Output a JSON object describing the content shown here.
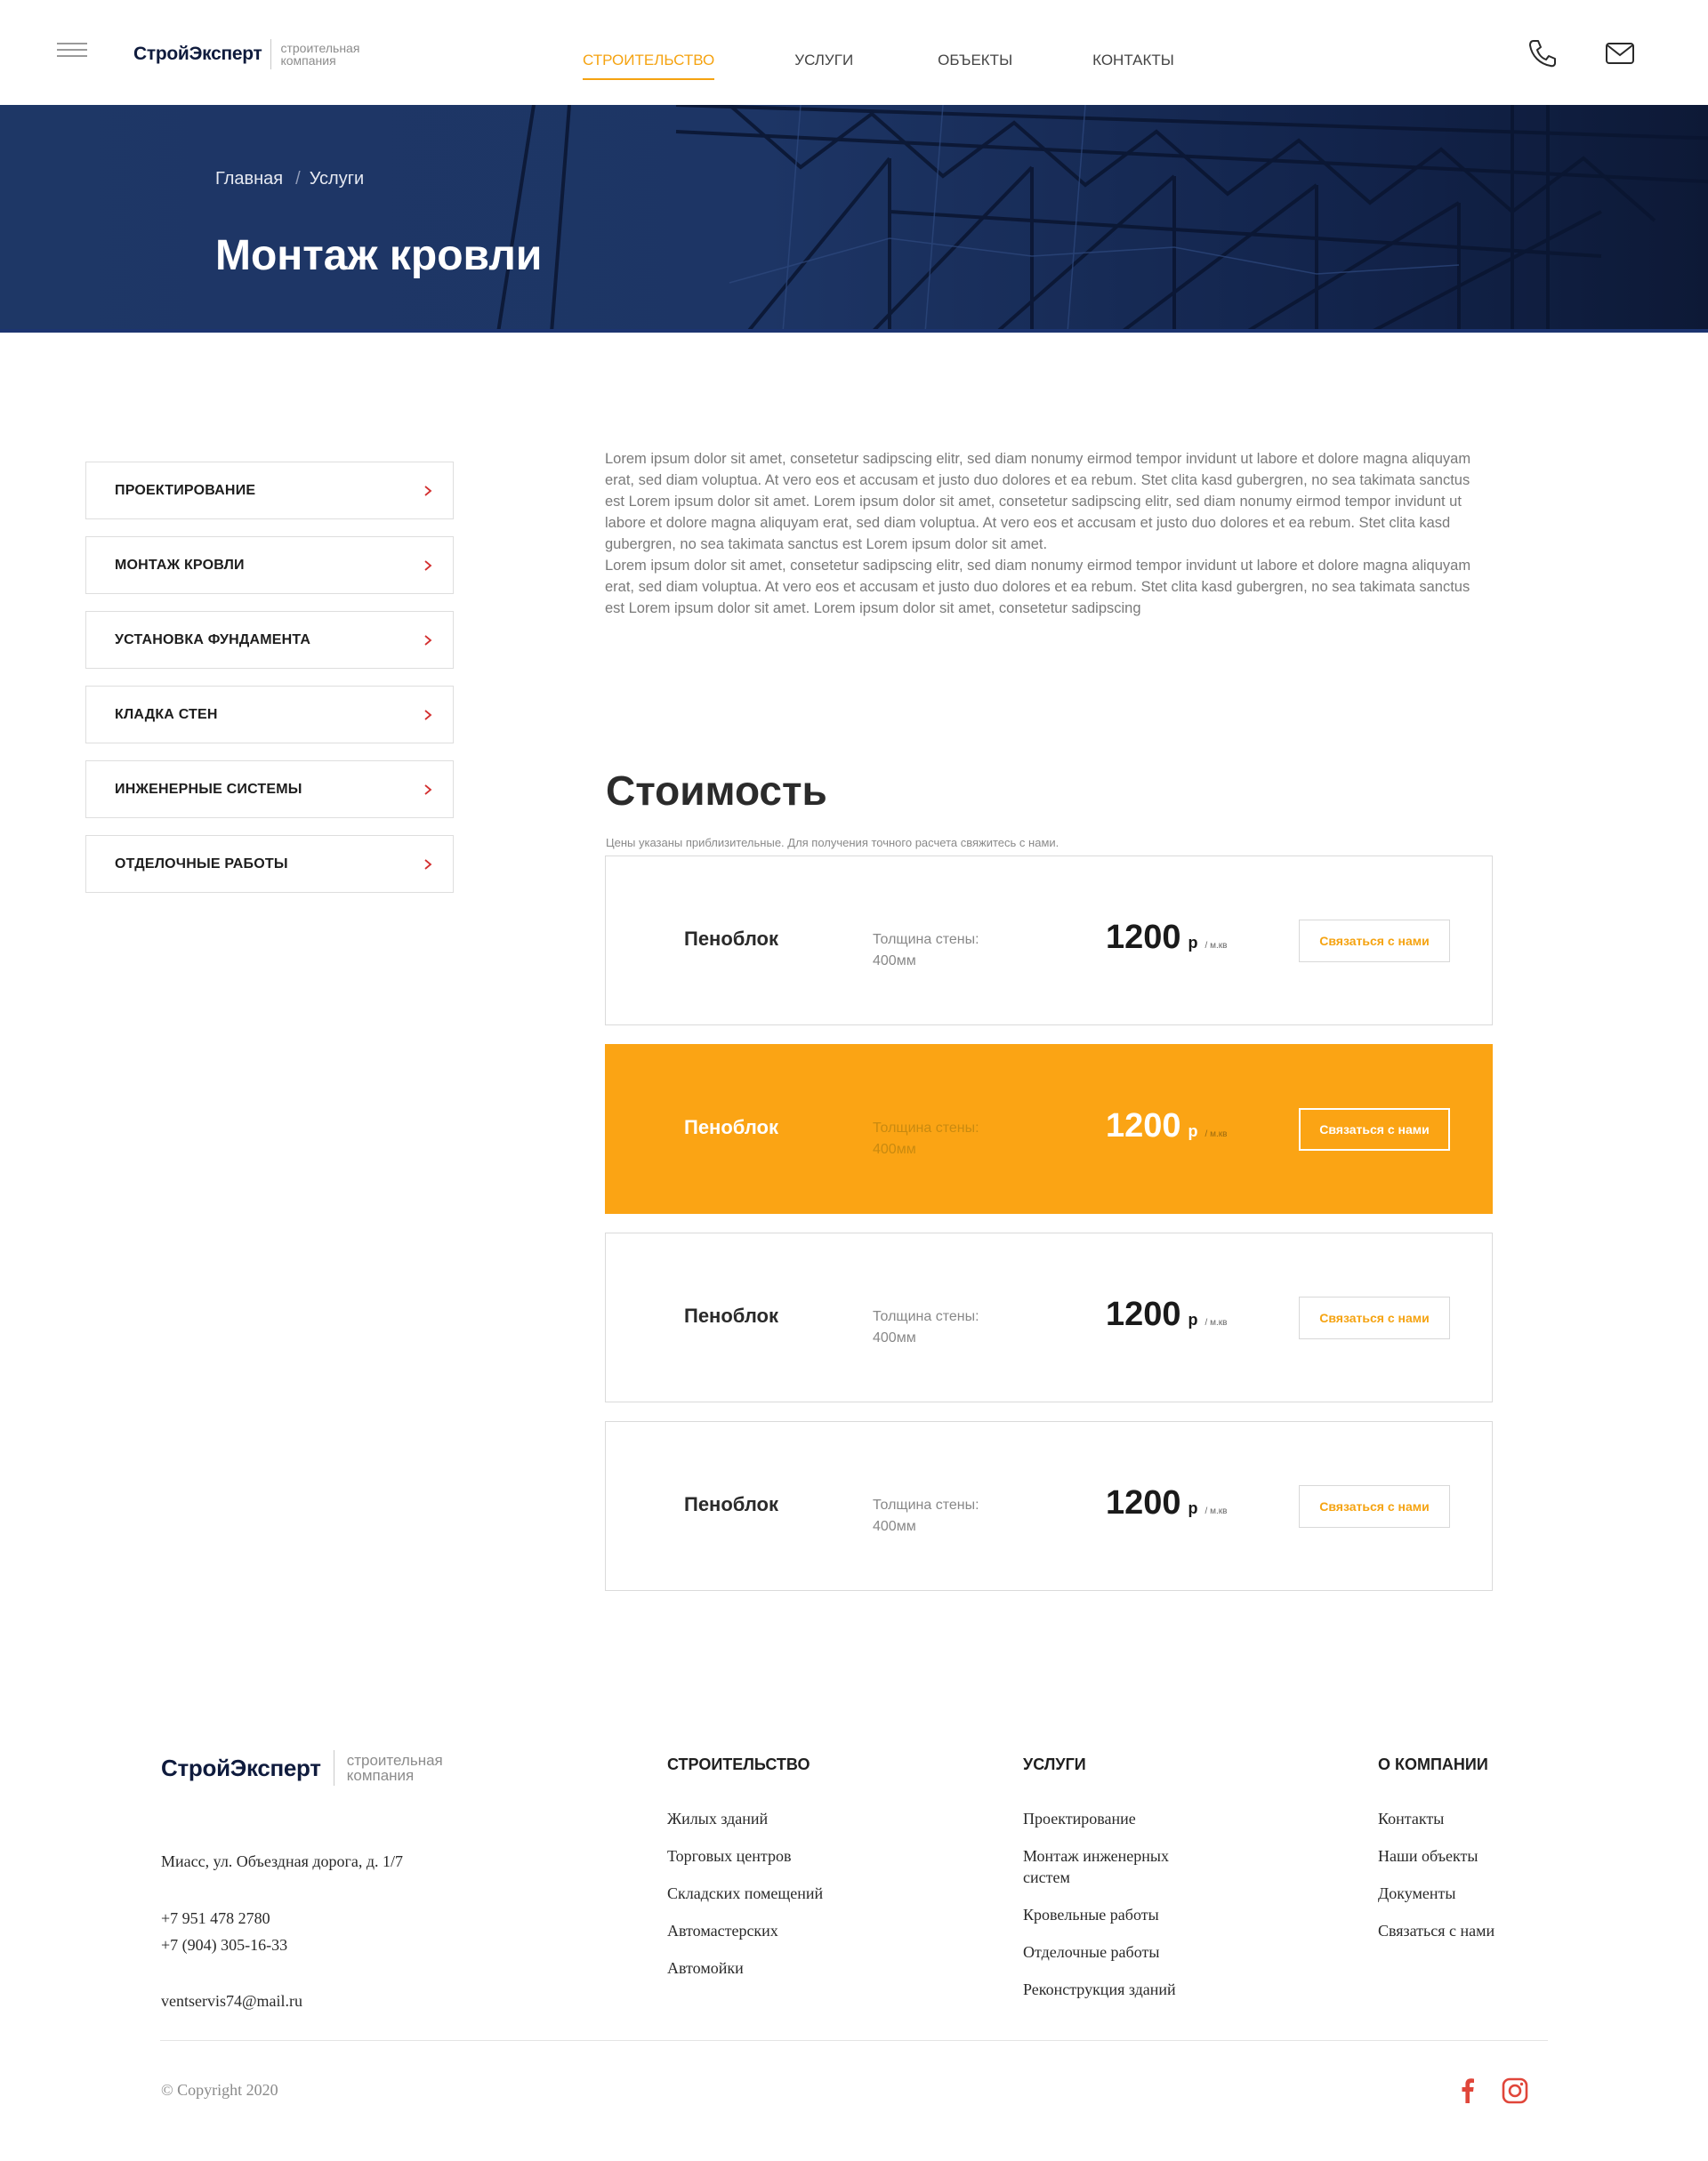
{
  "header": {
    "logo": {
      "brand": "СтройЭксперт",
      "sub_line1": "строительная",
      "sub_line2": "компания"
    },
    "nav": [
      {
        "label": "СТРОИТЕЛЬСТВО",
        "active": true
      },
      {
        "label": "УСЛУГИ",
        "active": false
      },
      {
        "label": "ОБЪЕКТЫ",
        "active": false
      },
      {
        "label": "КОНТАКТЫ",
        "active": false
      }
    ],
    "icons": [
      "menu-icon",
      "phone-icon",
      "mail-icon"
    ]
  },
  "hero": {
    "breadcrumb": [
      "Главная",
      "Услуги"
    ],
    "breadcrumb_separator": "/",
    "title": "Монтаж кровли"
  },
  "sidebar": {
    "items": [
      {
        "label": "ПРОЕКТИРОВАНИЕ"
      },
      {
        "label": "МОНТАЖ КРОВЛИ"
      },
      {
        "label": "УСТАНОВКА ФУНДАМЕНТА"
      },
      {
        "label": "КЛАДКА СТЕН"
      },
      {
        "label": "ИНЖЕНЕРНЫЕ СИСТЕМЫ"
      },
      {
        "label": "ОТДЕЛОЧНЫЕ РАБОТЫ"
      }
    ],
    "chevron_icon": "chevron-right-icon"
  },
  "intro": {
    "text": "Lorem ipsum dolor sit amet, consetetur sadipscing elitr, sed diam nonumy eirmod tempor invidunt ut labore et dolore magna aliquyam erat, sed diam voluptua. At vero eos et accusam et justo duo dolores et ea rebum. Stet clita kasd gubergren, no sea takimata sanctus est Lorem ipsum dolor sit amet. Lorem ipsum dolor sit amet, consetetur sadipscing elitr, sed diam nonumy eirmod tempor invidunt ut labore et dolore magna aliquyam erat, sed diam voluptua. At vero eos et accusam et justo duo dolores et ea rebum. Stet clita kasd gubergren, no sea takimata sanctus est Lorem ipsum dolor sit amet.\nLorem ipsum dolor sit amet, consetetur sadipscing elitr, sed diam nonumy eirmod tempor invidunt ut labore et dolore magna aliquyam erat, sed diam voluptua. At vero eos et accusam et justo duo dolores et ea rebum. Stet clita kasd gubergren, no sea takimata sanctus est Lorem ipsum dolor sit amet. Lorem ipsum dolor sit amet, consetetur sadipscing"
  },
  "pricing": {
    "title": "Стоимость",
    "note": "Цены указаны приблизительные.  Для получения  точного расчета свяжитесь с нами.",
    "cards": [
      {
        "name": "Пеноблок",
        "spec_line1": "Толщина стены:",
        "spec_line2": "400мм",
        "price": "1200",
        "currency": "р",
        "unit": "/ м.кв",
        "cta": "Связаться с нами",
        "highlighted": false
      },
      {
        "name": "Пеноблок",
        "spec_line1": "Толщина стены:",
        "spec_line2": "400мм",
        "price": "1200",
        "currency": "р",
        "unit": "/ м.кв",
        "cta": "Связаться с нами",
        "highlighted": true
      },
      {
        "name": "Пеноблок",
        "spec_line1": "Толщина стены:",
        "spec_line2": "400мм",
        "price": "1200",
        "currency": "р",
        "unit": "/ м.кв",
        "cta": "Связаться с нами",
        "highlighted": false
      },
      {
        "name": "Пеноблок",
        "spec_line1": "Толщина стены:",
        "spec_line2": "400мм",
        "price": "1200",
        "currency": "р",
        "unit": "/ м.кв",
        "cta": "Связаться с нами",
        "highlighted": false
      }
    ],
    "accent_color": "#fba414"
  },
  "footer": {
    "logo": {
      "brand": "СтройЭксперт",
      "sub_line1": "строительная",
      "sub_line2": "компания"
    },
    "address": "Миасс, ул. Объездная дорога, д. 1/7",
    "phone1": "+7 951 478 2780",
    "phone2": "+7 (904) 305-16-33",
    "email": "ventservis74@mail.ru",
    "columns": [
      {
        "title": "СТРОИТЕЛЬСТВО",
        "links": [
          "Жилых зданий",
          "Торговых центров",
          "Складских помещений",
          "Автомастерских",
          "Автомойки"
        ]
      },
      {
        "title": "УСЛУГИ",
        "links": [
          "Проектирование",
          "Монтаж инженерных систем",
          "Кровельные работы",
          "Отделочные работы",
          "Реконструкция зданий"
        ]
      },
      {
        "title": "О КОМПАНИИ",
        "links": [
          "Контакты",
          "Наши объекты",
          "Документы",
          "Связаться с нами"
        ]
      }
    ],
    "copyright": "© Copyright 2020",
    "social_icons": [
      "facebook-icon",
      "instagram-icon"
    ],
    "social_color": "#e0463a"
  }
}
